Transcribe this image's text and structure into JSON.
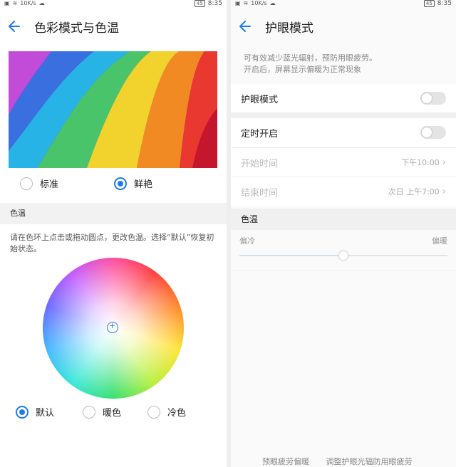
{
  "left": {
    "status": {
      "net": "10K/s",
      "battery": "45",
      "time": "8:35"
    },
    "title": "色彩模式与色温",
    "modes": [
      {
        "label": "标准",
        "selected": false
      },
      {
        "label": "鲜艳",
        "selected": true
      }
    ],
    "color_temp_header": "色温",
    "color_temp_desc": "请在色环上点击或拖动圆点，更改色温。选择“默认”恢复初始状态。",
    "presets": [
      {
        "label": "默认",
        "selected": true
      },
      {
        "label": "暖色",
        "selected": false
      },
      {
        "label": "冷色",
        "selected": false
      }
    ]
  },
  "right": {
    "status": {
      "net": "10K/s",
      "battery": "45",
      "time": "8:35"
    },
    "title": "护眼模式",
    "desc_line1": "可有效减少蓝光辐射，预防用眼疲劳。",
    "desc_line2": "开启后，屏幕显示偏暖为正常现象",
    "eye_mode_label": "护眼模式",
    "eye_mode_on": false,
    "schedule_label": "定时开启",
    "schedule_on": false,
    "start_label": "开始时间",
    "start_value": "下午10:00",
    "end_label": "结束时间",
    "end_value": "次日 上午7:00",
    "temp_header": "色温",
    "temp_cool": "偏冷",
    "temp_warm": "偏暖",
    "temp_level": 0.5,
    "bottom_hint_1": "预眼疲劳偏暖",
    "bottom_hint_2": "调整护眼光辐防用眼疲劳"
  },
  "colors": {
    "accent": "#1d7ce8"
  }
}
